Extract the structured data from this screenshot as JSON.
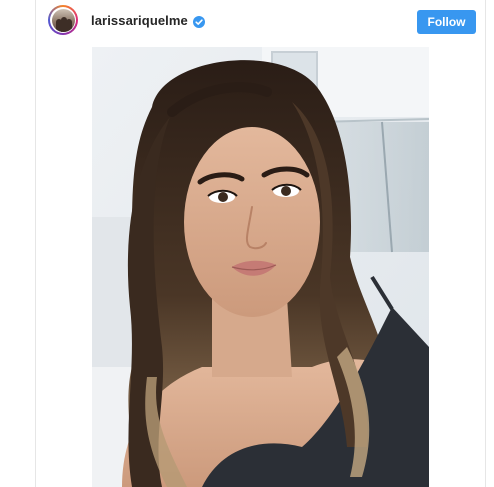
{
  "post": {
    "username": "larissariquelme",
    "verified": true,
    "follow_label": "Follow"
  },
  "colors": {
    "follow_button": "#3897f0",
    "verified_badge": "#3897f0",
    "username_text": "#262626"
  },
  "icons": {
    "verified": "verified-badge-icon"
  }
}
